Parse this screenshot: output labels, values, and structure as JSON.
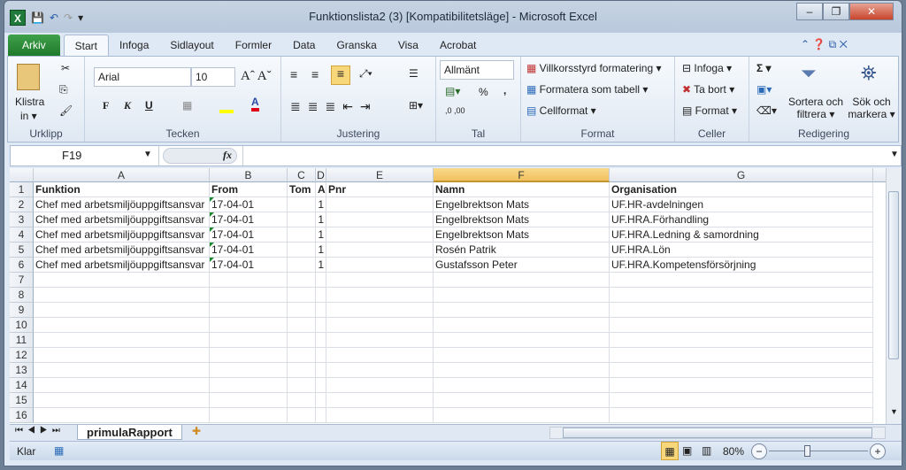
{
  "window": {
    "title": "Funktionslista2 (3)  [Kompatibilitetsläge] - Microsoft Excel",
    "minimize": "–",
    "restore": "❐",
    "close": "✕"
  },
  "quick_access": {
    "app_icon": "X",
    "save": "💾",
    "undo": "↶",
    "redo": "↷",
    "customize": "▾"
  },
  "tabs": [
    {
      "label": "Arkiv"
    },
    {
      "label": "Start"
    },
    {
      "label": "Infoga"
    },
    {
      "label": "Sidlayout"
    },
    {
      "label": "Formler"
    },
    {
      "label": "Data"
    },
    {
      "label": "Granska"
    },
    {
      "label": "Visa"
    },
    {
      "label": "Acrobat"
    }
  ],
  "ribbon": {
    "clipboard": {
      "label": "Urklipp",
      "paste": "Klistra",
      "paste2": "in ▾"
    },
    "font": {
      "label": "Tecken",
      "name": "Arial",
      "size": "10",
      "bold": "F",
      "italic": "K",
      "underline": "U"
    },
    "alignment": {
      "label": "Justering"
    },
    "number": {
      "label": "Tal",
      "format": "Allmänt",
      "percent": "%",
      "comma": ","
    },
    "styles": {
      "label": "Format",
      "conditional": "Villkorsstyrd formatering ▾",
      "as_table": "Formatera som tabell ▾",
      "cell_styles": "Cellformat ▾"
    },
    "cells": {
      "label": "Celler",
      "insert": "Infoga ▾",
      "delete": "Ta bort ▾",
      "format": "Format ▾"
    },
    "editing": {
      "label": "Redigering",
      "sum": "Σ ▾",
      "sort1": "Sortera och",
      "sort2": "filtrera ▾",
      "find1": "Sök och",
      "find2": "markera ▾"
    }
  },
  "formula_bar": {
    "name_box": "F19",
    "fx": "fx",
    "value": ""
  },
  "columns": [
    "A",
    "B",
    "C",
    "D",
    "E",
    "F",
    "G"
  ],
  "selected_column": "F",
  "rows": [
    [
      "Funktion",
      "From",
      "Tom",
      "A",
      "Pnr",
      "Namn",
      "Organisation"
    ],
    [
      "Chef med arbetsmiljöuppgiftsansvar",
      "17-04-01",
      "",
      "1",
      "",
      "Engelbrektson Mats",
      "UF.HR-avdelningen"
    ],
    [
      "Chef med arbetsmiljöuppgiftsansvar",
      "17-04-01",
      "",
      "1",
      "",
      "Engelbrektson Mats",
      "UF.HRA.Förhandling"
    ],
    [
      "Chef med arbetsmiljöuppgiftsansvar",
      "17-04-01",
      "",
      "1",
      "",
      "Engelbrektson Mats",
      "UF.HRA.Ledning & samordning"
    ],
    [
      "Chef med arbetsmiljöuppgiftsansvar",
      "17-04-01",
      "",
      "1",
      "",
      "Rosén Patrik",
      "UF.HRA.Lön"
    ],
    [
      "Chef med arbetsmiljöuppgiftsansvar",
      "17-04-01",
      "",
      "1",
      "",
      "Gustafsson Peter",
      "UF.HRA.Kompetensförsörjning"
    ]
  ],
  "row_count": 16,
  "sheet": {
    "name": "primulaRapport"
  },
  "status": {
    "text": "Klar",
    "zoom": "80%",
    "zoom_minus": "−",
    "zoom_plus": "+"
  }
}
